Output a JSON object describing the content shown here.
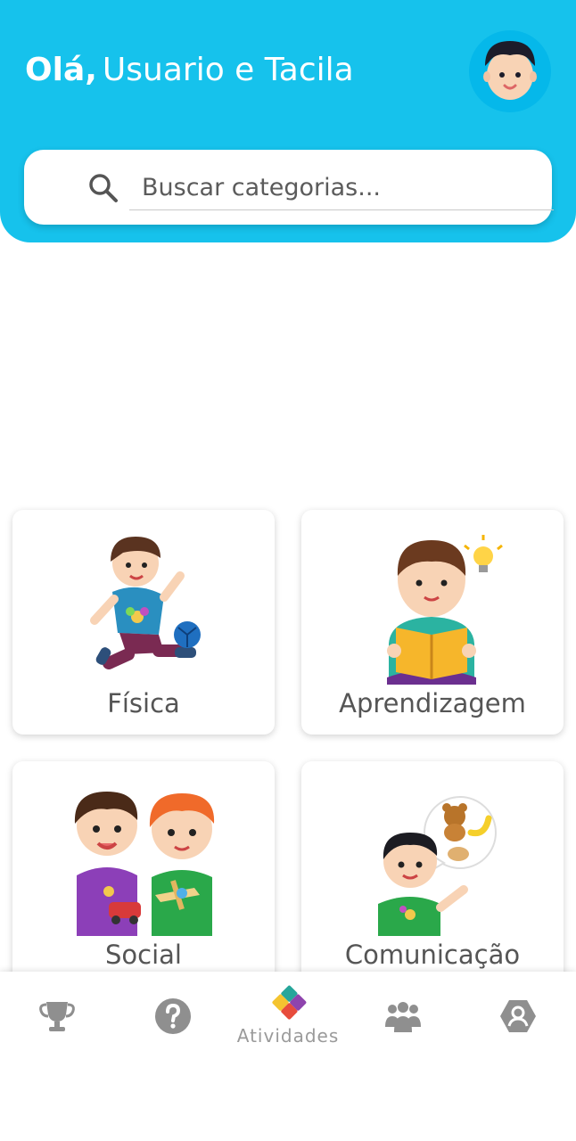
{
  "header": {
    "greeting": "Olá,",
    "user_name": "Usuario e Tacila",
    "avatar": "boy-avatar"
  },
  "search": {
    "placeholder": "Buscar categorias...",
    "value": "",
    "icon": "search-icon"
  },
  "categories": [
    {
      "label": "Física",
      "illustration": "boy-kicking-ball"
    },
    {
      "label": "Aprendizagem",
      "illustration": "boy-reading-book"
    },
    {
      "label": "Social",
      "illustration": "two-boys-sharing-toys"
    },
    {
      "label": "Comunicação",
      "illustration": "boy-thinking-of-toys"
    }
  ],
  "bottom_nav": {
    "items": [
      {
        "icon": "trophy-icon"
      },
      {
        "icon": "question-icon"
      },
      {
        "icon": "puzzle-icon",
        "label": "Atividades",
        "active": true
      },
      {
        "icon": "group-icon"
      },
      {
        "icon": "profile-icon"
      }
    ]
  },
  "colors": {
    "primary": "#16c2ec",
    "text": "#555555",
    "nav_inactive": "#9a9a9a"
  }
}
